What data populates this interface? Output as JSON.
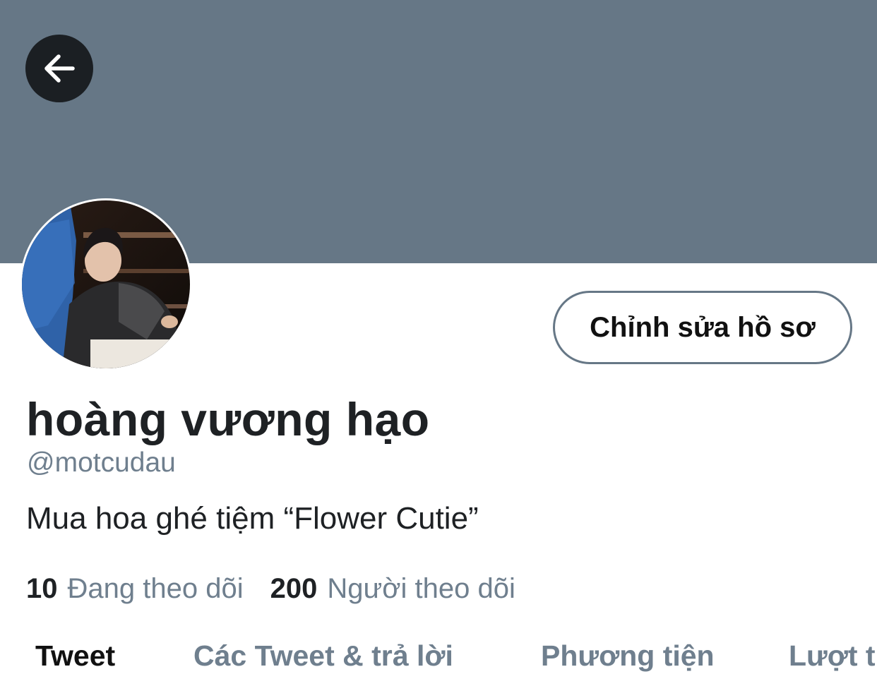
{
  "header": {
    "back_icon": "arrow-left-icon",
    "banner_color": "#667786"
  },
  "profile": {
    "display_name": "hoàng vương hạo",
    "handle": "@motcudau",
    "bio": "Mua hoa ghé tiệm “Flower Cutie”",
    "edit_button_label": "Chỉnh sửa hồ sơ",
    "following_count": "10",
    "following_label": "Đang theo dõi",
    "followers_count": "200",
    "followers_label": "Người theo dõi"
  },
  "tabs": [
    {
      "label": "Tweet",
      "active": true
    },
    {
      "label": "Các Tweet & trả lời",
      "active": false
    },
    {
      "label": "Phương tiện",
      "active": false
    },
    {
      "label": "Lượt thích",
      "active": false
    }
  ],
  "colors": {
    "secondary_text": "#6f7f8e",
    "primary_text": "#1e2124"
  }
}
